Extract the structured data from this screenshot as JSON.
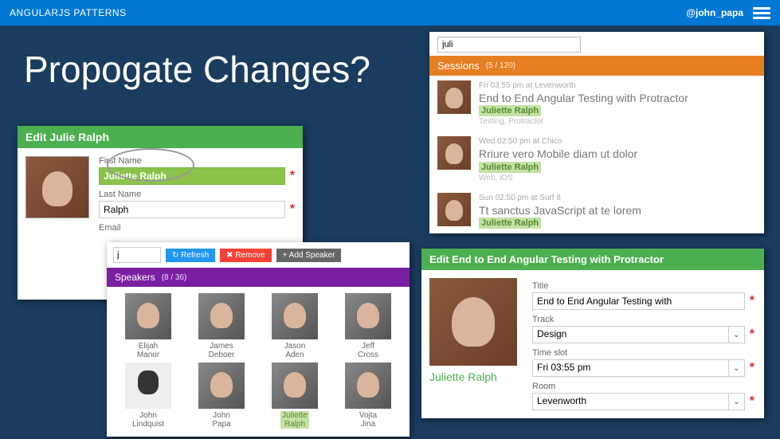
{
  "topbar": {
    "title": "ANGULARJS PATTERNS",
    "handle": "@john_papa"
  },
  "slide": {
    "title": "Propogate Changes?"
  },
  "panel1": {
    "header": "Edit Julie Ralph",
    "first_label": "First Name",
    "first_value": "Juliette Ralph",
    "last_label": "Last Name",
    "last_value": "Ralph",
    "email_label": "Email"
  },
  "panel2": {
    "search": "juli",
    "header": "Sessions",
    "count": "(5 / 120)",
    "rows": [
      {
        "meta": "Fri 03:55 pm at Levenworth",
        "title": "End to End Angular Testing with Protractor",
        "speaker": "Juliette Ralph",
        "tags": "Testing, Protractor"
      },
      {
        "meta": "Wed 02:50 pm at Chico",
        "title": "Rriure vero Mobile diam ut dolor",
        "speaker": "Juliette Ralph",
        "tags": "Web, iOS"
      },
      {
        "meta": "Sun 02:50 pm at Surf 8",
        "title": "Tt sanctus JavaScript at te lorem",
        "speaker": "Juliette Ralph",
        "tags": ""
      }
    ]
  },
  "panel3": {
    "search": "j",
    "refresh": "↻ Refresh",
    "remove": "✖ Remove",
    "add": "+ Add Speaker",
    "header": "Speakers",
    "count": "(8 / 36)",
    "speakers": [
      {
        "first": "Elijah",
        "last": "Manor"
      },
      {
        "first": "James",
        "last": "Deboer"
      },
      {
        "first": "Jason",
        "last": "Aden"
      },
      {
        "first": "Jeff",
        "last": "Cross"
      },
      {
        "first": "John",
        "last": "Lindquist"
      },
      {
        "first": "John",
        "last": "Papa"
      },
      {
        "first": "Juliette",
        "last": "Ralph"
      },
      {
        "first": "Vojta",
        "last": "Jina"
      }
    ]
  },
  "panel4": {
    "header": "Edit End to End Angular Testing with Protractor",
    "speaker": "Juliette Ralph",
    "title_label": "Title",
    "title_value": "End to End Angular Testing with",
    "track_label": "Track",
    "track_value": "Design",
    "timeslot_label": "Time slot",
    "timeslot_value": "Fri 03:55 pm",
    "room_label": "Room",
    "room_value": "Levenworth"
  }
}
